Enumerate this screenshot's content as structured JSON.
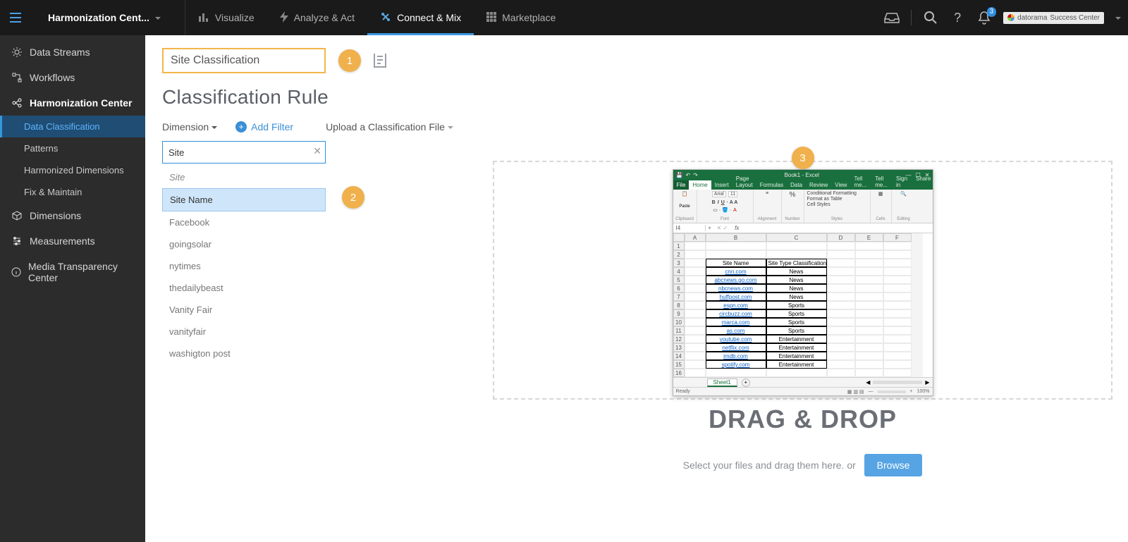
{
  "topbar": {
    "workspace": "Harmonization Cent...",
    "tabs": {
      "visualize": "Visualize",
      "analyze": "Analyze & Act",
      "connect": "Connect & Mix",
      "marketplace": "Marketplace"
    },
    "notifications_count": "3",
    "success_center_brand": "datorama",
    "success_center_label": "Success Center"
  },
  "sidebar": {
    "items": {
      "data_streams": "Data Streams",
      "workflows": "Workflows",
      "harmonization_center": "Harmonization Center",
      "dimensions": "Dimensions",
      "measurements": "Measurements",
      "media_transparency": "Media Transparency Center"
    },
    "hc_sub": {
      "data_classification": "Data Classification",
      "patterns": "Patterns",
      "harmonized_dimensions": "Harmonized Dimensions",
      "fix_maintain": "Fix & Maintain"
    }
  },
  "rule": {
    "name_value": "Site Classification",
    "section_title": "Classification Rule",
    "dimension_label": "Dimension",
    "add_filter": "Add Filter",
    "upload_label": "Upload a Classification File",
    "search_value": "Site",
    "dd_group_label": "Site",
    "dd_options": {
      "site_name": "Site Name",
      "facebook": "Facebook",
      "goingsolar": "goingsolar",
      "nytimes": "nytimes",
      "thedailybeast": "thedailybeast",
      "vanity_fair": "Vanity Fair",
      "vanityfair": "vanityfair",
      "washington_post": "washigton post"
    }
  },
  "markers": {
    "one": "1",
    "two": "2",
    "three": "3"
  },
  "upload": {
    "dnd": "DRAG & DROP",
    "hint": "Select your files and drag them here. or",
    "browse": "Browse"
  },
  "excel": {
    "title": "Book1 - Excel",
    "ribbon_tabs": [
      "File",
      "Home",
      "Insert",
      "Page Layout",
      "Formulas",
      "Data",
      "Review",
      "View"
    ],
    "ribbon_right": [
      "Tell me...",
      "Sign in",
      "Share"
    ],
    "font_name": "Arial",
    "font_size": "11",
    "groups": {
      "clipboard": "Clipboard",
      "font": "Font",
      "alignment": "Alignment",
      "number": "Number",
      "styles_cf": "Conditional Formatting",
      "styles_ft": "Format as Table",
      "styles_cs": "Cell Styles",
      "styles": "Styles",
      "cells": "Cells",
      "editing": "Editing",
      "paste": "Paste",
      "percent": "%"
    },
    "active_cell": "I4",
    "fx": "fx",
    "cols": [
      "A",
      "B",
      "C",
      "D",
      "E",
      "F"
    ],
    "header_b": "Site Name",
    "header_c": "Site Type Classification",
    "rows": [
      {
        "n": "1"
      },
      {
        "n": "2"
      },
      {
        "n": "3",
        "b": "Site Name",
        "c": "Site Type Classification",
        "head": true
      },
      {
        "n": "4",
        "b": "cnn.com",
        "c": "News"
      },
      {
        "n": "5",
        "b": "abcnews.go.com",
        "c": "News"
      },
      {
        "n": "6",
        "b": "nbcnews.com",
        "c": "News"
      },
      {
        "n": "7",
        "b": "huffpost.com",
        "c": "News"
      },
      {
        "n": "8",
        "b": "espn.com",
        "c": "Sports"
      },
      {
        "n": "9",
        "b": "circbuzz.com",
        "c": "Sports"
      },
      {
        "n": "10",
        "b": "marca.com",
        "c": "Sports"
      },
      {
        "n": "11",
        "b": "as.com",
        "c": "Sports"
      },
      {
        "n": "12",
        "b": "youtube.com",
        "c": "Entertainment"
      },
      {
        "n": "13",
        "b": "netflix.com",
        "c": "Entertainment"
      },
      {
        "n": "14",
        "b": "imdb.com",
        "c": "Entertainment"
      },
      {
        "n": "15",
        "b": "spotify.com",
        "c": "Entertainment"
      },
      {
        "n": "16"
      }
    ],
    "sheet": "Sheet1",
    "status_left": "Ready",
    "zoom": "100%"
  }
}
